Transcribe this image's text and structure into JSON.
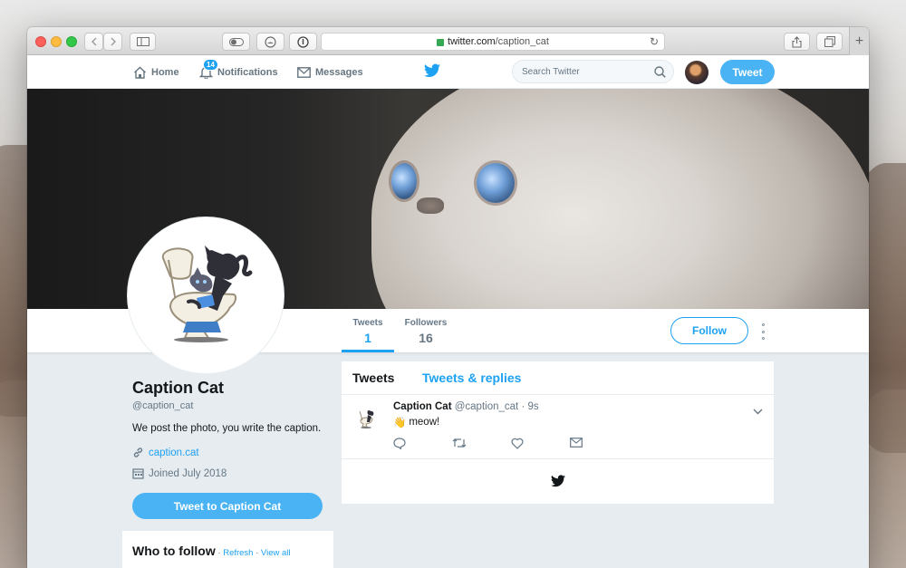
{
  "browser": {
    "url_domain": "twitter.com",
    "url_path": "/caption_cat"
  },
  "nav": {
    "home_label": "Home",
    "notifications_label": "Notifications",
    "notifications_count": "14",
    "messages_label": "Messages",
    "search_placeholder": "Search Twitter",
    "tweet_button_label": "Tweet"
  },
  "profile": {
    "name": "Caption Cat",
    "handle": "@caption_cat",
    "bio": "We post the photo, you write the caption.",
    "link": "caption.cat",
    "joined": "Joined July 2018",
    "tweet_to_label": "Tweet to Caption Cat",
    "follow_label": "Follow"
  },
  "stats": [
    {
      "label": "Tweets",
      "value": "1"
    },
    {
      "label": "Followers",
      "value": "16"
    }
  ],
  "timeline": {
    "tabs": [
      "Tweets",
      "Tweets & replies"
    ],
    "tweets": [
      {
        "name": "Caption Cat",
        "handle": "@caption_cat",
        "time": "· 9s",
        "emoji": "👋",
        "text": "meow!"
      }
    ]
  },
  "who_to_follow": {
    "title": "Who to follow",
    "sep1": " · ",
    "refresh": "Refresh",
    "sep2": " · ",
    "view_all": "View all"
  },
  "colors": {
    "accent": "#1da1f2",
    "button": "#4ab3f4",
    "page_bg": "#e6ecf0"
  }
}
